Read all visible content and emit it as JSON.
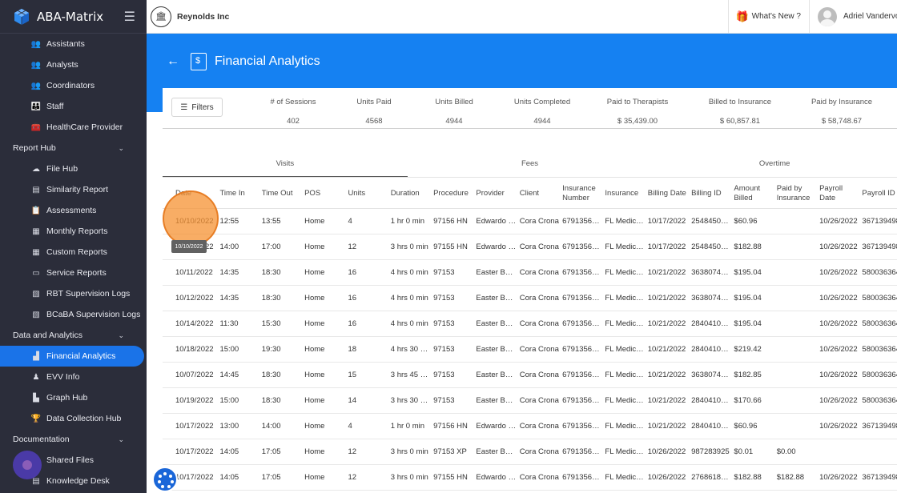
{
  "app": {
    "name": "ABA-Matrix"
  },
  "sidebar": {
    "items": [
      {
        "label": "Assistants",
        "icon": "people-icon",
        "glyph": "👥",
        "type": "item"
      },
      {
        "label": "Analysts",
        "icon": "people-icon",
        "glyph": "👥",
        "type": "item"
      },
      {
        "label": "Coordinators",
        "icon": "people-icon",
        "glyph": "👥",
        "type": "item"
      },
      {
        "label": "Staff",
        "icon": "staff-icon",
        "glyph": "👪",
        "type": "item"
      },
      {
        "label": "HealthCare Provider",
        "icon": "medical-bag-icon",
        "glyph": "🧰",
        "type": "item"
      },
      {
        "label": "Report Hub",
        "type": "group"
      },
      {
        "label": "File Hub",
        "icon": "cloud-icon",
        "glyph": "☁",
        "type": "item"
      },
      {
        "label": "Similarity Report",
        "icon": "document-icon",
        "glyph": "▤",
        "type": "item"
      },
      {
        "label": "Assessments",
        "icon": "clipboard-icon",
        "glyph": "📋",
        "type": "item"
      },
      {
        "label": "Monthly Reports",
        "icon": "calendar-icon",
        "glyph": "▦",
        "type": "item"
      },
      {
        "label": "Custom Reports",
        "icon": "calendar-icon",
        "glyph": "▦",
        "type": "item"
      },
      {
        "label": "Service Reports",
        "icon": "chat-icon",
        "glyph": "▭",
        "type": "item"
      },
      {
        "label": "RBT Supervision Logs",
        "icon": "log-icon",
        "glyph": "▧",
        "type": "item"
      },
      {
        "label": "BCaBA Supervision Logs",
        "icon": "log-icon",
        "glyph": "▧",
        "type": "item"
      },
      {
        "label": "Data and Analytics",
        "type": "group"
      },
      {
        "label": "Financial Analytics",
        "icon": "chart-icon",
        "glyph": "▟",
        "type": "item",
        "active": true
      },
      {
        "label": "EVV Info",
        "icon": "person-pin-icon",
        "glyph": "♟",
        "type": "item"
      },
      {
        "label": "Graph Hub",
        "icon": "bar-chart-icon",
        "glyph": "▙",
        "type": "item"
      },
      {
        "label": "Data Collection Hub",
        "icon": "trophy-icon",
        "glyph": "🏆",
        "type": "item"
      },
      {
        "label": "Documentation",
        "type": "group"
      },
      {
        "label": "Shared Files",
        "icon": "folder-icon",
        "glyph": "▬",
        "type": "item"
      },
      {
        "label": "Knowledge Desk",
        "icon": "book-icon",
        "glyph": "▤",
        "type": "item"
      }
    ]
  },
  "topbar": {
    "org_name": "Reynolds Inc",
    "whats_new": "What's New ?",
    "user_name": "Adriel Vandervort"
  },
  "page": {
    "title": "Financial Analytics"
  },
  "filters_label": "Filters",
  "stats": [
    {
      "label": "# of Sessions",
      "value": "402"
    },
    {
      "label": "Units Paid",
      "value": "4568"
    },
    {
      "label": "Units Billed",
      "value": "4944"
    },
    {
      "label": "Units Completed",
      "value": "4944"
    },
    {
      "label": "Paid to Therapists",
      "value": "$ 35,439.00"
    },
    {
      "label": "Billed to Insurance",
      "value": "$ 60,857.81"
    },
    {
      "label": "Paid by Insurance",
      "value": "$ 58,748.67"
    }
  ],
  "tabs": [
    {
      "label": "Visits",
      "active": true
    },
    {
      "label": "Fees",
      "active": false
    },
    {
      "label": "Overtime",
      "active": false
    }
  ],
  "tooltip": "10/10/2022",
  "table": {
    "headers": [
      "Date",
      "Time In",
      "Time Out",
      "POS",
      "Units",
      "Duration",
      "Procedure",
      "Provider",
      "Client",
      "Insurance Number",
      "Insurance",
      "Billing Date",
      "Billing ID",
      "Amount Billed",
      "Paid by Insurance",
      "Payroll Date",
      "Payroll ID"
    ],
    "rows": [
      [
        "10/10/2022",
        "12:55",
        "13:55",
        "Home",
        "4",
        "1 hr 0 min",
        "97156 HN",
        "Edwardo G...",
        "Cora Crona",
        "6791356674",
        "FL Medicaid",
        "10/17/2022",
        "2548450061",
        "$60.96",
        "",
        "10/26/2022",
        "3671394983"
      ],
      [
        "10/10/2022",
        "14:00",
        "17:00",
        "Home",
        "12",
        "3 hrs 0 min",
        "97155 HN",
        "Edwardo G...",
        "Cora Crona",
        "6791356674",
        "FL Medicaid",
        "10/17/2022",
        "2548450061",
        "$182.88",
        "",
        "10/26/2022",
        "3671394983"
      ],
      [
        "10/11/2022",
        "14:35",
        "18:30",
        "Home",
        "16",
        "4 hrs 0 min",
        "97153",
        "Easter Bau...",
        "Cora Crona",
        "6791356674",
        "FL Medicaid",
        "10/21/2022",
        "3638074579",
        "$195.04",
        "",
        "10/26/2022",
        "580036364"
      ],
      [
        "10/12/2022",
        "14:35",
        "18:30",
        "Home",
        "16",
        "4 hrs 0 min",
        "97153",
        "Easter Bau...",
        "Cora Crona",
        "6791356674",
        "FL Medicaid",
        "10/21/2022",
        "3638074579",
        "$195.04",
        "",
        "10/26/2022",
        "580036364"
      ],
      [
        "10/14/2022",
        "11:30",
        "15:30",
        "Home",
        "16",
        "4 hrs 0 min",
        "97153",
        "Easter Bau...",
        "Cora Crona",
        "6791356674",
        "FL Medicaid",
        "10/21/2022",
        "2840410409",
        "$195.04",
        "",
        "10/26/2022",
        "580036364"
      ],
      [
        "10/18/2022",
        "15:00",
        "19:30",
        "Home",
        "18",
        "4 hrs 30 min",
        "97153",
        "Easter Bau...",
        "Cora Crona",
        "6791356674",
        "FL Medicaid",
        "10/21/2022",
        "2840410409",
        "$219.42",
        "",
        "10/26/2022",
        "580036364"
      ],
      [
        "10/07/2022",
        "14:45",
        "18:30",
        "Home",
        "15",
        "3 hrs 45 min",
        "97153",
        "Easter Bau...",
        "Cora Crona",
        "6791356674",
        "FL Medicaid",
        "10/21/2022",
        "3638074579",
        "$182.85",
        "",
        "10/26/2022",
        "580036364"
      ],
      [
        "10/19/2022",
        "15:00",
        "18:30",
        "Home",
        "14",
        "3 hrs 30 min",
        "97153",
        "Easter Bau...",
        "Cora Crona",
        "6791356674",
        "FL Medicaid",
        "10/21/2022",
        "2840410409",
        "$170.66",
        "",
        "10/26/2022",
        "580036364"
      ],
      [
        "10/17/2022",
        "13:00",
        "14:00",
        "Home",
        "4",
        "1 hr 0 min",
        "97156 HN",
        "Edwardo G...",
        "Cora Crona",
        "6791356674",
        "FL Medicaid",
        "10/21/2022",
        "2840410409",
        "$60.96",
        "",
        "10/26/2022",
        "3671394983"
      ],
      [
        "10/17/2022",
        "14:05",
        "17:05",
        "Home",
        "12",
        "3 hrs 0 min",
        "97153 XP",
        "Easter Bau...",
        "Cora Crona",
        "6791356674",
        "FL Medicaid",
        "10/26/2022",
        "987283925",
        "$0.01",
        "$0.00",
        "",
        ""
      ],
      [
        "10/17/2022",
        "14:05",
        "17:05",
        "Home",
        "12",
        "3 hrs 0 min",
        "97155 HN",
        "Edwardo G...",
        "Cora Crona",
        "6791356674",
        "FL Medicaid",
        "10/26/2022",
        "2768618740",
        "$182.88",
        "$182.88",
        "10/26/2022",
        "3671394983"
      ]
    ]
  }
}
